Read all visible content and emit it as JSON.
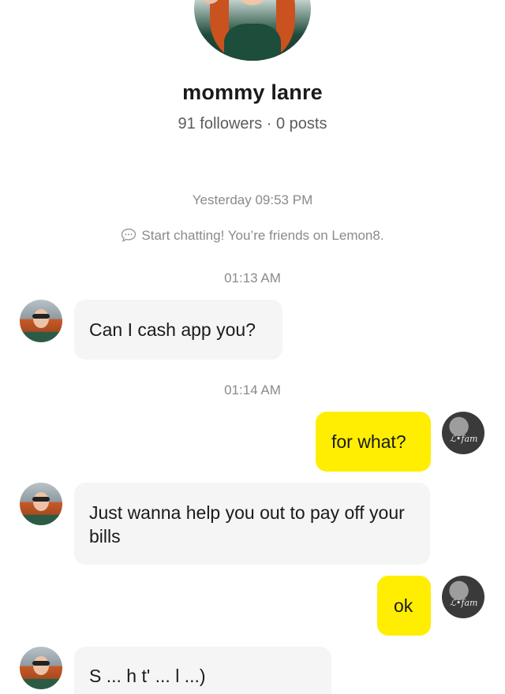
{
  "profile": {
    "name": "mommy lanre",
    "stats": "91 followers · 0 posts"
  },
  "chat": {
    "timestamp_1": "Yesterday 09:53 PM",
    "system_message": "Start chatting! You’re friends on Lemon8.",
    "timestamp_2": "01:13 AM",
    "timestamp_3": "01:14 AM",
    "messages": [
      {
        "from": "them",
        "text": "Can I cash app you?"
      },
      {
        "from": "me",
        "text": "for what?"
      },
      {
        "from": "them",
        "text": "Just wanna help you out to pay off your bills"
      },
      {
        "from": "me",
        "text": "ok"
      },
      {
        "from": "them",
        "text": "S ... h t' ... l ...)"
      }
    ]
  },
  "colors": {
    "outgoing_bubble": "#ffee00",
    "incoming_bubble": "#f5f5f5",
    "meta_text": "#8a8a8a"
  },
  "icons": {
    "system_message_icon": "chat-bubble-icon"
  }
}
